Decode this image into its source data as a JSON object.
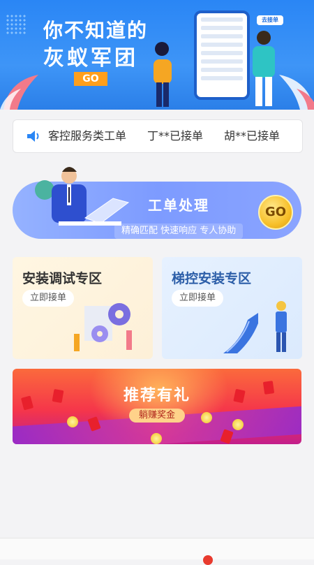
{
  "banner": {
    "line1": "你不知道的",
    "line2": "灰蚁军团",
    "go_label": "GO",
    "bubble_label": "去接单"
  },
  "notice": {
    "icon": "speaker-icon",
    "items": [
      "客控服务类工单",
      "丁**已接单",
      "胡**已接单"
    ]
  },
  "work_order": {
    "title": "工单处理",
    "subtitle": "精确匹配  快速响应  专人协助",
    "go_label": "GO"
  },
  "zones": [
    {
      "title": "安装调试专区",
      "button": "立即接单"
    },
    {
      "title": "梯控安装专区",
      "button": "立即接单"
    }
  ],
  "promo": {
    "title": "推荐有礼",
    "button": "躺赚奖金"
  },
  "colors": {
    "banner_blue": "#2a86f5",
    "accent_orange": "#ff9f1c",
    "work_purple": "#8aa4ff",
    "promo_red": "#f5364a"
  }
}
